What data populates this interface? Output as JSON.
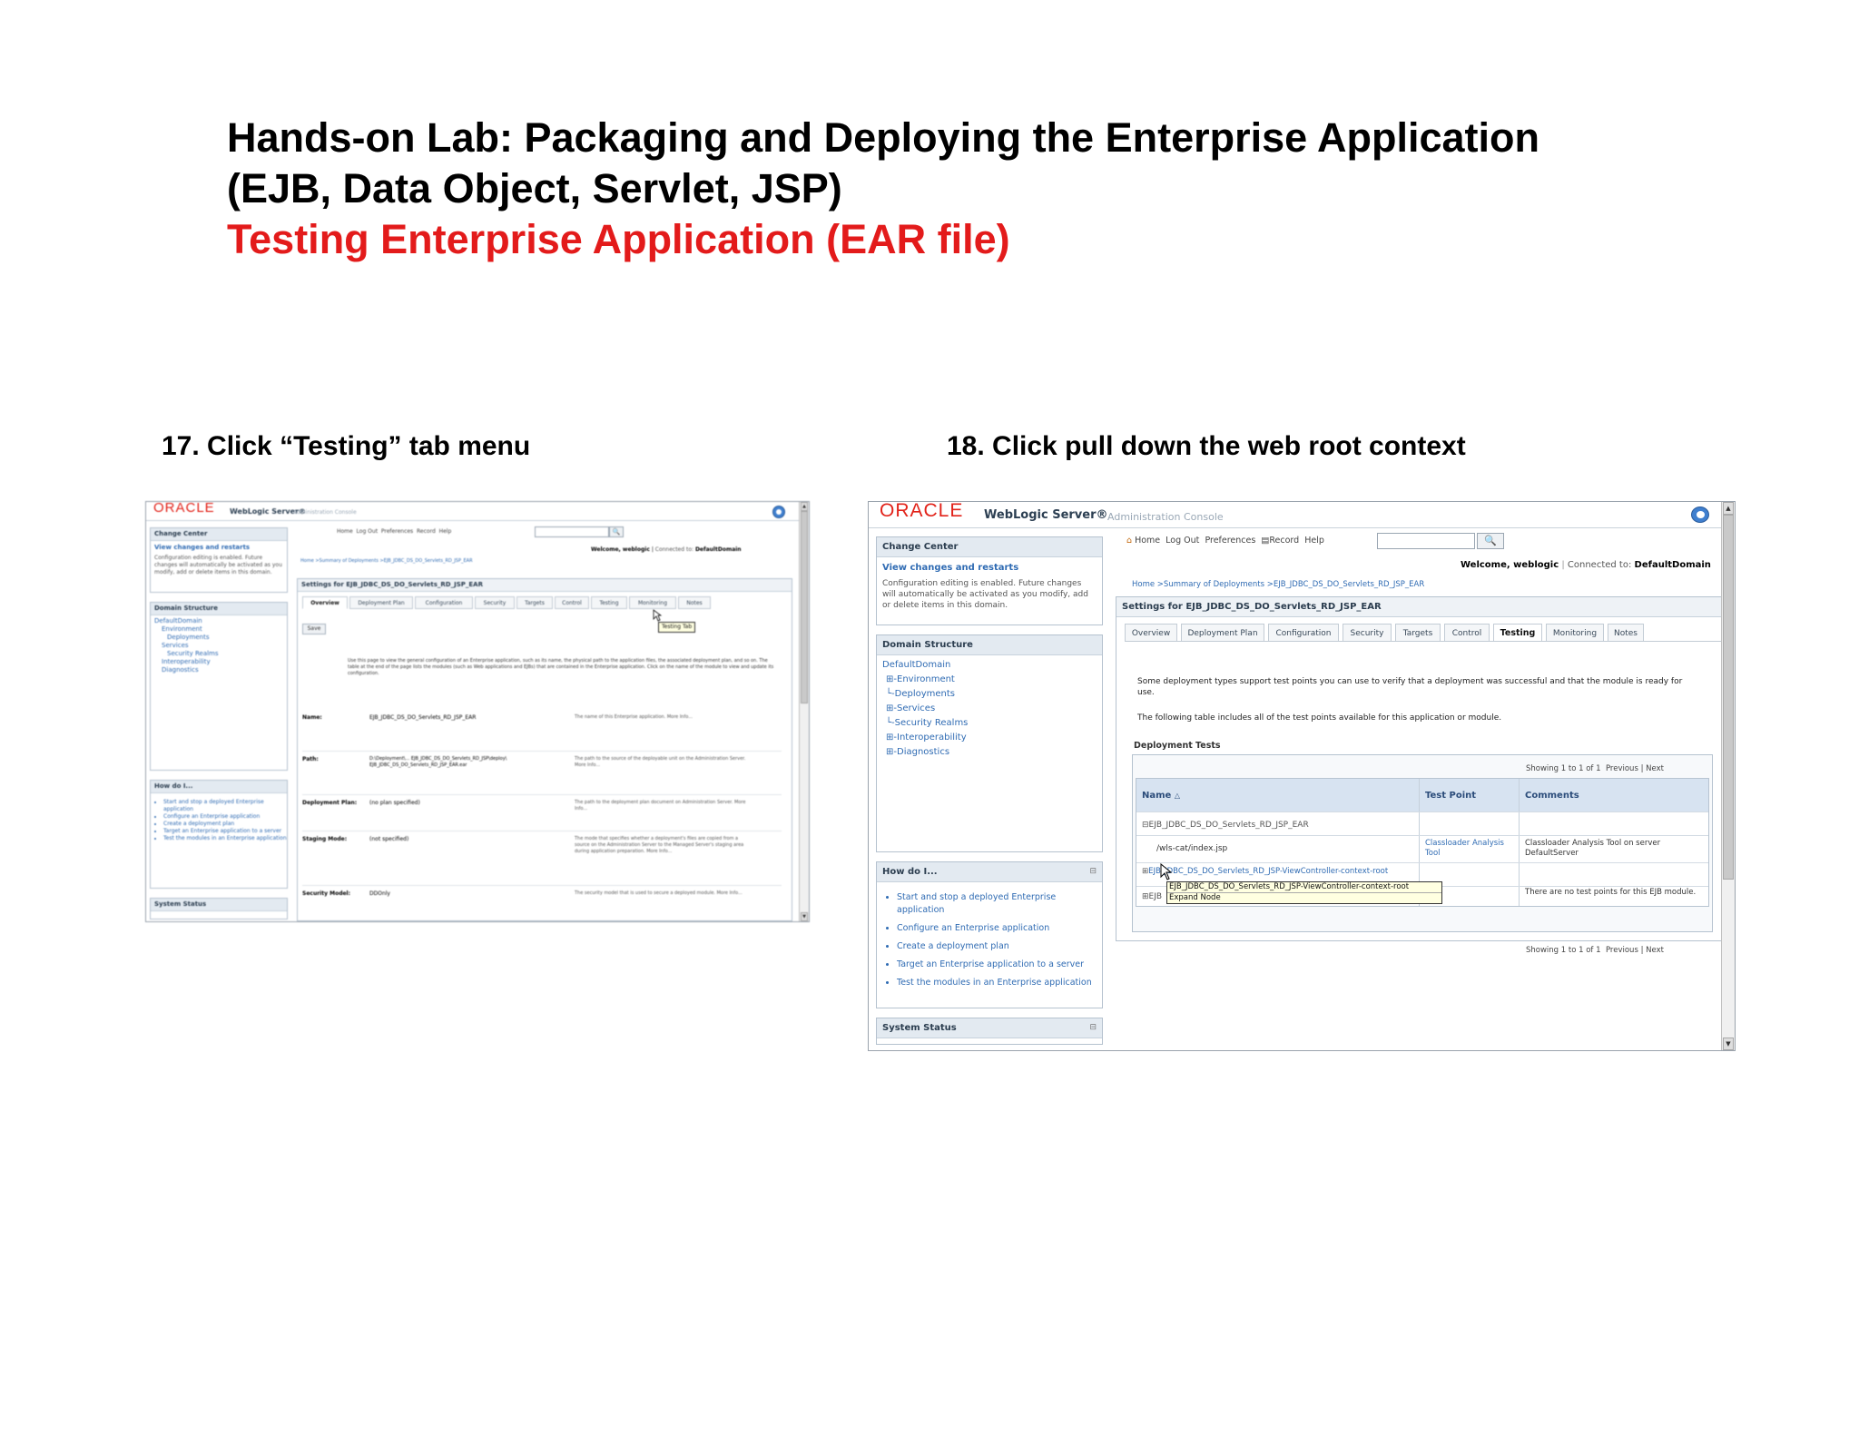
{
  "slide": {
    "title_line1": "Hands-on Lab: Packaging and Deploying the Enterprise Application",
    "title_line2": "(EJB, Data Object, Servlet, JSP)",
    "subtitle": "Testing Enterprise Application (EAR file)",
    "step17": "17. Click “Testing” tab menu",
    "step18": "18. Click pull down the web root context"
  },
  "colors": {
    "accent_red": "#e31b1b",
    "oracle_red": "#e2231a",
    "link_blue": "#2f6bb3"
  },
  "console": {
    "oracle_logo": "ORACLE",
    "product": "WebLogic Server®",
    "product_sub": "Administration Console",
    "toolbar": {
      "home": "Home",
      "logout": "Log Out",
      "preferences": "Preferences",
      "record": "Record",
      "help": "Help"
    },
    "welcome": "Welcome, weblogic",
    "connected_label": "Connected to:",
    "connected_domain": "DefaultDomain",
    "breadcrumb": "Home >Summary of Deployments >EJB_JDBC_DS_DO_Servlets_RD_JSP_EAR",
    "settings_title": "Settings for EJB_JDBC_DS_DO_Servlets_RD_JSP_EAR",
    "tabs": [
      "Overview",
      "Deployment Plan",
      "Configuration",
      "Security",
      "Targets",
      "Control",
      "Testing",
      "Monitoring",
      "Notes"
    ],
    "change_center": {
      "heading": "Change Center",
      "link": "View changes and restarts",
      "text": "Configuration editing is enabled. Future changes will automatically be activated as you modify, add or delete items in this domain."
    },
    "domain_structure": {
      "heading": "Domain Structure",
      "root": "DefaultDomain",
      "items": [
        "Environment",
        "Deployments",
        "Services",
        "Security Realms",
        "Interoperability",
        "Diagnostics"
      ]
    },
    "how_do_i": {
      "heading": "How do I...",
      "items": [
        "Start and stop a deployed Enterprise application",
        "Configure an Enterprise application",
        "Create a deployment plan",
        "Target an Enterprise application to a server",
        "Test the modules in an Enterprise application"
      ]
    },
    "system_status": "System Status"
  },
  "shot17": {
    "save_button": "Save",
    "tooltip": "Testing Tab",
    "intro": "Use this page to view the general configuration of an Enterprise application, such as its name, the physical path to the application files, the associated deployment plan, and so on. The table at the end of the page lists the modules (such as Web applications and EJBs) that are contained in the Enterprise application. Click on the name of the module to view and update its configuration.",
    "fields": [
      {
        "label": "Name:",
        "value": "EJB_JDBC_DS_DO_Servlets_RD_JSP_EAR",
        "help": "The name of this Enterprise application. More Info..."
      },
      {
        "label": "Path:",
        "value": "D:\\Deployment\\... EJB_JDBC_DS_DO_Servlets_RD_JSP\\deploy\\ EJB_JDBC_DS_DO_Servlets_RD_JSP_EAR.ear",
        "help": "The path to the source of the deployable unit on the Administration Server. More Info..."
      },
      {
        "label": "Deployment Plan:",
        "value": "(no plan specified)",
        "help": "The path to the deployment plan document on Administration Server. More Info..."
      },
      {
        "label": "Staging Mode:",
        "value": "(not specified)",
        "help": "The mode that specifies whether a deployment's files are copied from a source on the Administration Server to the Managed Server's staging area during application preparation. More Info..."
      },
      {
        "label": "Security Model:",
        "value": "DDOnly",
        "help": "The security model that is used to secure a deployed module. More Info..."
      }
    ]
  },
  "shot18": {
    "intro1": "Some deployment types support test points you can use to verify that a deployment was successful and that the module is ready for use.",
    "intro2": "The following table includes all of the test points available for this application or module.",
    "section": "Deployment Tests",
    "paging": "Showing 1 to 1 of 1",
    "previous": "Previous",
    "next": "Next",
    "columns": [
      "Name",
      "Test Point",
      "Comments"
    ],
    "rows": [
      {
        "name": "EJB_JDBC_DS_DO_Servlets_RD_JSP_EAR",
        "test_point": "",
        "comments": ""
      },
      {
        "name": "/wls-cat/index.jsp",
        "test_point": "Classloader Analysis Tool",
        "comments": "Classloader Analysis Tool on server DefaultServer"
      },
      {
        "name": "EJB_JDBC_DS_DO_Servlets_RD_JSP-ViewController-context-root",
        "test_point": "",
        "comments": ""
      },
      {
        "name": "EJB",
        "test_point": "",
        "comments": "There are no test points for this EJB module."
      }
    ],
    "tooltip_path": "EJB_JDBC_DS_DO_Servlets_RD_JSP-ViewController-context-root",
    "tooltip_action": "Expand Node"
  }
}
